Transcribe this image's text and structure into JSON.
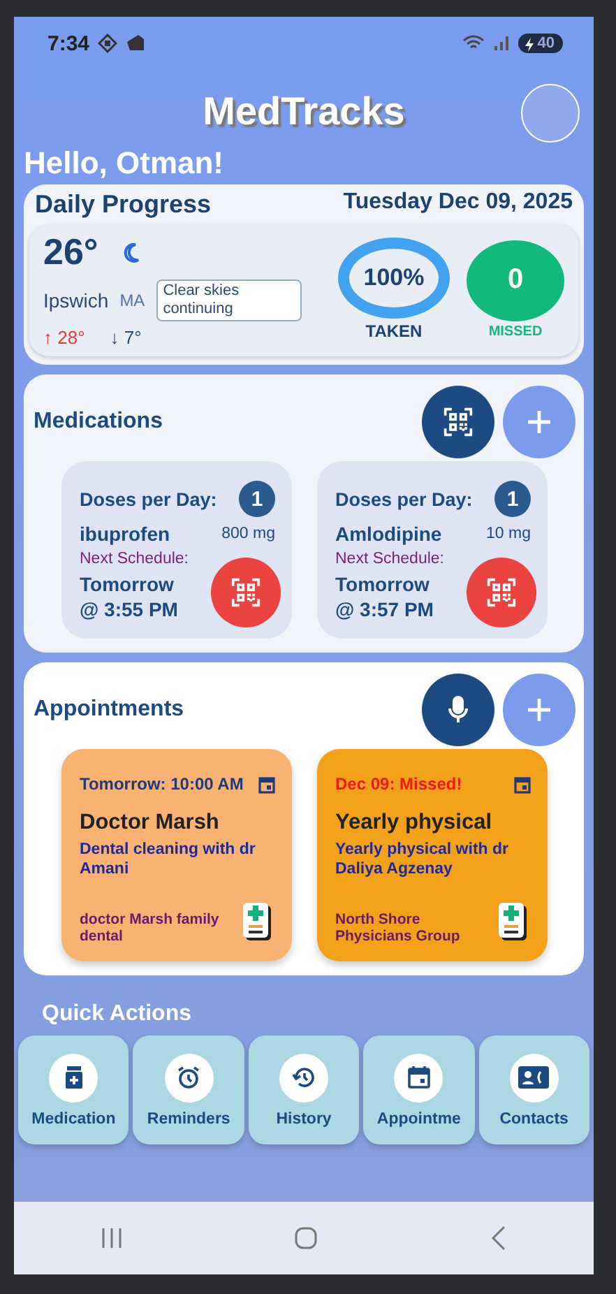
{
  "status_bar": {
    "time": "7:34",
    "battery": "40"
  },
  "header": {
    "title": "MedTracks",
    "greeting": "Hello, Otman!"
  },
  "daily_progress": {
    "title": "Daily Progress",
    "date": "Tuesday Dec 09, 2025",
    "weather": {
      "temperature": "26°",
      "city": "Ipswich",
      "state": "MA",
      "condition": "Clear skies continuing",
      "high": "↑ 28°",
      "low": "↓ 7°"
    },
    "taken": {
      "value": "100%",
      "label": "TAKEN"
    },
    "missed": {
      "value": "0",
      "label": "MISSED"
    }
  },
  "medications": {
    "title": "Medications",
    "items": [
      {
        "doses_label": "Doses per Day:",
        "doses": "1",
        "name": "ibuprofen",
        "strength": "800 mg",
        "next_label": "Next Schedule:",
        "next": "Tomorrow\n@ 3:55 PM"
      },
      {
        "doses_label": "Doses per Day:",
        "doses": "1",
        "name": "Amlodipine",
        "strength": "10 mg",
        "next_label": "Next Schedule:",
        "next": "Tomorrow\n@ 3:57 PM"
      }
    ]
  },
  "appointments": {
    "title": "Appointments",
    "items": [
      {
        "when": "Tomorrow: 10:00 AM",
        "missed": false,
        "title": "Doctor Marsh",
        "description": "Dental cleaning with dr Amani",
        "place": "doctor Marsh family dental"
      },
      {
        "when": "Dec 09: Missed!",
        "missed": true,
        "title": "Yearly physical",
        "description": "Yearly physical with dr Daliya Agzenay",
        "place": "North Shore Physicians Group"
      }
    ]
  },
  "quick_actions": {
    "title": "Quick Actions",
    "items": [
      {
        "kind": "medication",
        "label": "Medication"
      },
      {
        "kind": "alarm",
        "label": "Reminders"
      },
      {
        "kind": "history",
        "label": "History"
      },
      {
        "kind": "calendar",
        "label": "Appointme"
      },
      {
        "kind": "contacts",
        "label": "Contacts"
      }
    ]
  }
}
